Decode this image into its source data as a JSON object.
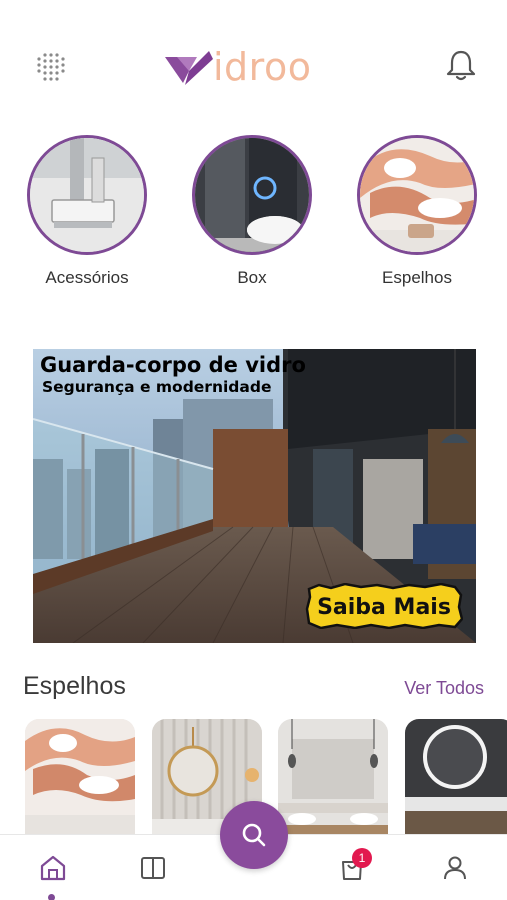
{
  "header": {
    "logo_text": "idroo",
    "menu_icon": "grid-dots-icon",
    "notification_icon": "bell-icon"
  },
  "categories": [
    {
      "label": "Acessórios"
    },
    {
      "label": "Box"
    },
    {
      "label": "Espelhos"
    }
  ],
  "banner": {
    "title": "Guarda-corpo de vidro",
    "subtitle": "Segurança e modernidade",
    "cta": "Saiba Mais"
  },
  "section": {
    "title": "Espelhos",
    "see_all": "Ver Todos"
  },
  "bottom_nav": {
    "items": [
      "home-icon",
      "catalog-icon",
      "search-icon",
      "cart-icon",
      "profile-icon"
    ],
    "cart_badge": "1"
  },
  "colors": {
    "brand_purple": "#7e4a95",
    "brand_peach": "#f2b99b",
    "badge_red": "#e2194f"
  }
}
